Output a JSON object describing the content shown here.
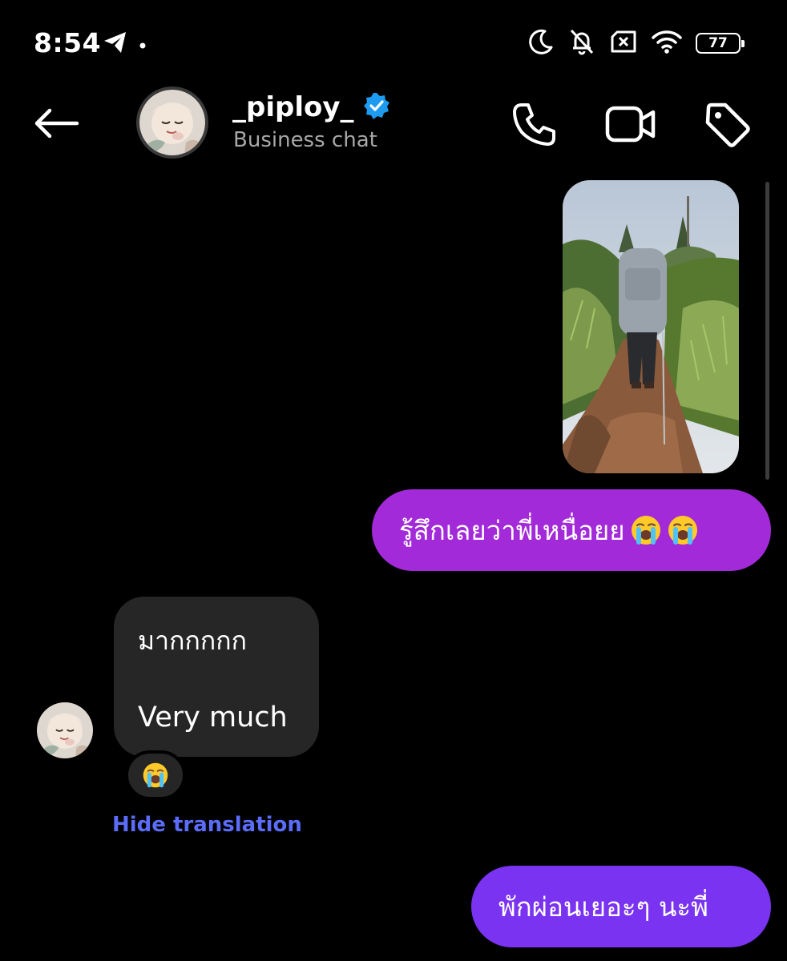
{
  "status_bar": {
    "time": "8:54",
    "battery": "77",
    "icons": [
      "telegram-icon",
      "dot-icon",
      "moon-icon",
      "bell-off-icon",
      "no-sim-icon",
      "wifi-icon",
      "battery-icon"
    ]
  },
  "header": {
    "username": "_piploy_",
    "subtitle": "Business chat",
    "verified": true,
    "actions": [
      "phone-icon",
      "video-icon",
      "tag-icon"
    ],
    "accent": "#1d9bf0"
  },
  "messages": [
    {
      "type": "image",
      "from": "me",
      "description": "photo"
    },
    {
      "type": "text",
      "from": "me",
      "text": "รู้สึกเลยว่าพี่เหนื่อยย",
      "emojis": [
        "loudly-crying-face",
        "loudly-crying-face"
      ],
      "color": "#a22ad8"
    },
    {
      "type": "text",
      "from": "them",
      "original": "มากกกกก",
      "translation": "Very much",
      "reaction": "loudly-crying-face",
      "hide_translation_label": "Hide translation"
    },
    {
      "type": "text",
      "from": "me",
      "text": "พักผ่อนเยอะๆ นะพี่",
      "color": "#7a33f0"
    }
  ],
  "colors": {
    "background": "#000000",
    "incoming_bubble": "#262626",
    "link": "#5b6cf8"
  }
}
